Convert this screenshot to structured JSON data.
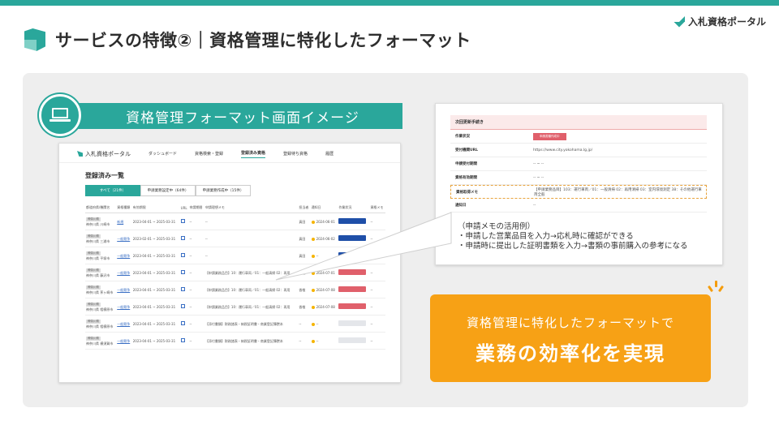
{
  "brand": {
    "logo_text": "入札資格ポータル",
    "accent": "#2aa79b",
    "cta_color": "#f7a115"
  },
  "slide": {
    "title": "サービスの特徴②｜資格管理に特化したフォーマット"
  },
  "banner": {
    "label": "資格管理フォーマット画面イメージ"
  },
  "app": {
    "brand": "入札資格ポータル",
    "nav": [
      "ダッシュボード",
      "資格検索・登録",
      "登録済み資格",
      "登録待ち資格",
      "履歴"
    ],
    "heading": "登録済み一覧",
    "tabs": [
      "すべて（21件）",
      "申請業務設定中（64件）",
      "申請業務作成中（15件）"
    ],
    "columns": [
      "都道府県/機関名",
      "資格種類",
      "有効期限",
      "URL",
      "申請期間",
      "申請理想メモ",
      "担当者",
      "通知日",
      "作業状況",
      "資格メモ"
    ],
    "rows": [
      {
        "tag": "神奈川県",
        "org": "神奈川県 川崎市",
        "type": "新規",
        "period": "2023-04-01 ~ 2025-03-31",
        "url": "",
        "apply": "--",
        "memo": "--",
        "person": "真田",
        "notify": "2024-06-01",
        "status": "blue"
      },
      {
        "tag": "神奈川県",
        "org": "神奈川県 三浦市",
        "type": "一般競争",
        "period": "2023-02-01 ~ 2025-03-31",
        "url": "",
        "apply": "--",
        "memo": "--",
        "person": "真田",
        "notify": "2024-06-02",
        "status": "blue"
      },
      {
        "tag": "神奈川県",
        "org": "神奈川県 平塚市",
        "type": "一般競争",
        "period": "2023-04-01 ~ 2025-03-31",
        "url": "",
        "apply": "--",
        "memo": "--",
        "person": "真田",
        "notify": "--",
        "status": "blue"
      },
      {
        "tag": "神奈川県",
        "org": "神奈川県 藤沢市",
        "type": "一般競争",
        "period": "2023-04-01 ~ 2025-03-31",
        "url": "",
        "apply": "--",
        "memo": "【申請業務品目】10：運行車両／01：一般清掃 02：再用",
        "person": "香椎",
        "notify": "2024-07-01",
        "status": "red"
      },
      {
        "tag": "神奈川県",
        "org": "神奈川県 茅ヶ崎市",
        "type": "一般競争",
        "period": "2023-04-01 ~ 2025-03-31",
        "url": "",
        "apply": "--",
        "memo": "【申請業務品目】10：運行車両／01：一般清掃 02：再用",
        "person": "香椎",
        "notify": "2024-07-08",
        "status": "red"
      },
      {
        "tag": "神奈川県",
        "org": "神奈川県 相模原市",
        "type": "一般競争",
        "period": "2023-04-01 ~ 2025-03-31",
        "url": "",
        "apply": "--",
        "memo": "【申請業務品目】10：運行車両／01：一般清掃 02：再用",
        "person": "香椎",
        "notify": "2024-07-08",
        "status": "red"
      },
      {
        "tag": "神奈川県",
        "org": "神奈川県 相模原市",
        "type": "一般競争",
        "period": "2023-04-01 ~ 2025-03-31",
        "url": "",
        "apply": "--",
        "memo": "【添付書類】財務諸表・納税証明書・商業登記簿謄本",
        "person": "--",
        "notify": "--",
        "status": "gray"
      },
      {
        "tag": "神奈川県",
        "org": "神奈川県 横須賀市",
        "type": "一般競争",
        "period": "2023-04-01 ~ 2025-03-31",
        "url": "",
        "apply": "--",
        "memo": "【添付書類】財務諸表・納税証明書・商業登記簿謄本",
        "person": "--",
        "notify": "--",
        "status": "gray"
      }
    ]
  },
  "detail": {
    "header": "次回更新手続き",
    "rows": [
      {
        "k": "作業状況",
        "v": "申請書類作成中",
        "type": "badge"
      },
      {
        "k": "受付機関URL",
        "v": "https://www.city.yokohama.lg.jp/"
      },
      {
        "k": "申請受付期間",
        "v": "-- ~ --"
      },
      {
        "k": "資格有効期間",
        "v": "-- ~ --"
      },
      {
        "k": "資格取得メモ",
        "v": "【申請業務品目】103：運行車両／01：一般清掃 02：再用清掃 03：室内環境測定 38：その他運行車両全般",
        "type": "memo"
      },
      {
        "k": "通知日",
        "v": "--"
      }
    ]
  },
  "note": {
    "lines": [
      "（申請メモの活用例）",
      "・申請した営業品目を入力→応札時に確認ができる",
      "・申請時に提出した証明書類を入力→書類の事前購入の参考になる"
    ]
  },
  "cta": {
    "line1": "資格管理に特化したフォーマットで",
    "line2": "業務の効率化を実現"
  }
}
